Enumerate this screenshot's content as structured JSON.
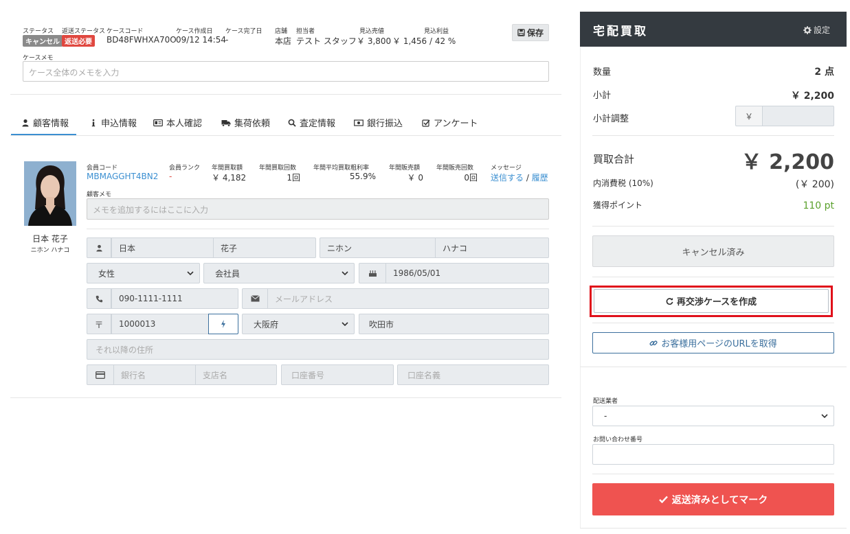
{
  "header": {
    "status_label": "ステータス",
    "status_badge": "キャンセル",
    "return_status_label": "返送ステータス",
    "return_status_badge": "返送必要",
    "case_code_label": "ケースコード",
    "case_code": "BD48FWHXA70O",
    "created_label": "ケース作成日",
    "created": "09/12 14:54",
    "completed_label": "ケース完了日",
    "completed": "-",
    "store_label": "店舗",
    "store": "本店",
    "staff_label": "担当者",
    "staff": "テスト スタッフ",
    "est_sale_label": "見込売値",
    "est_sale": "￥ 3,800",
    "est_profit_label": "見込利益",
    "est_profit": "￥ 1,456 / 42 %",
    "save_label": "保存",
    "memo_label": "ケースメモ",
    "memo_placeholder": "ケース全体のメモを入力"
  },
  "tabs": [
    {
      "label": "顧客情報",
      "icon": "user-icon",
      "active": true
    },
    {
      "label": "申込情報",
      "icon": "info-icon"
    },
    {
      "label": "本人確認",
      "icon": "id-card-icon"
    },
    {
      "label": "集荷依頼",
      "icon": "truck-icon"
    },
    {
      "label": "査定情報",
      "icon": "search-icon"
    },
    {
      "label": "銀行振込",
      "icon": "money-icon"
    },
    {
      "label": "アンケート",
      "icon": "checkbox-icon"
    }
  ],
  "customer": {
    "name": "日本 花子",
    "kana": "ニホン ハナコ",
    "member_code_label": "会員コード",
    "member_code": "MBMAGGHT4BN2",
    "rank_label": "会員ランク",
    "rank": "-",
    "annual_buy_amount_label": "年間買取額",
    "annual_buy_amount": "￥ 4,182",
    "annual_buy_count_label": "年間買取回数",
    "annual_buy_count": "1回",
    "avg_margin_label": "年間平均買取粗利率",
    "avg_margin": "55.9%",
    "annual_sale_amount_label": "年間販売額",
    "annual_sale_amount": "￥ 0",
    "annual_sale_count_label": "年間販売回数",
    "annual_sale_count": "0回",
    "message_label": "メッセージ",
    "send_link": "送信する",
    "separator": "/",
    "history_link": "履歴",
    "memo_label": "顧客メモ",
    "memo_placeholder": "メモを追加するにはここに入力"
  },
  "form": {
    "last_name": "日本",
    "first_name": "花子",
    "last_kana": "ニホン",
    "first_kana": "ハナコ",
    "gender": "女性",
    "occupation": "会社員",
    "birthday": "1986/05/01",
    "phone": "090-1111-1111",
    "email_placeholder": "メールアドレス",
    "postal_symbol": "〒",
    "postal": "1000013",
    "prefecture": "大阪府",
    "city": "吹田市",
    "address_placeholder": "それ以降の住所",
    "bank_placeholder": "銀行名",
    "branch_placeholder": "支店名",
    "account_no_placeholder": "口座番号",
    "account_name_placeholder": "口座名義"
  },
  "panel": {
    "title": "宅配買取",
    "settings_label": "設定",
    "qty_label": "数量",
    "qty": "2 点",
    "subtotal_label": "小計",
    "subtotal": "￥ 2,200",
    "adjust_label": "小計調整",
    "adjust_prefix": "￥",
    "total_label": "買取合計",
    "total": "￥ 2,200",
    "tax_label": "内消費税 (10%)",
    "tax": "(￥ 200)",
    "points_label": "獲得ポイント",
    "points": "110 pt",
    "cancelled_label": "キャンセル済み",
    "renegotiate_label": "再交渉ケースを作成",
    "url_label": "お客様用ページのURLを取得",
    "carrier_label": "配送業者",
    "carrier_value": "-",
    "tracking_label": "お問い合わせ番号",
    "mark_returned_label": "返送済みとしてマーク"
  },
  "colors": {
    "accent": "#3b8fd1",
    "dark_header": "#343a40",
    "danger": "#ef5350",
    "highlight": "#e0101a",
    "points_green": "#5aa02c"
  }
}
